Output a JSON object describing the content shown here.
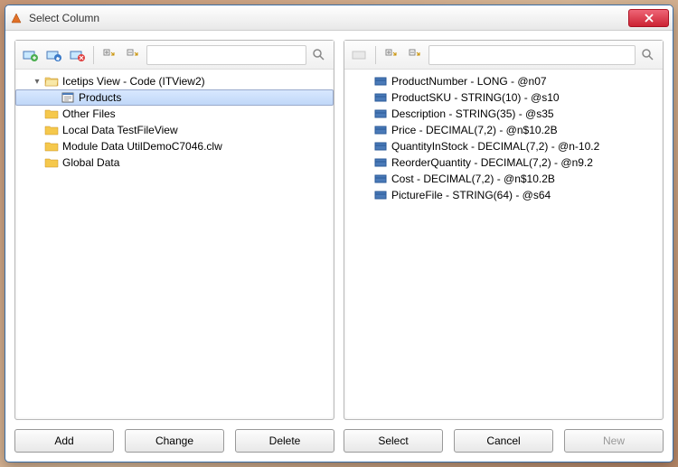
{
  "window": {
    "title": "Select Column"
  },
  "leftPanel": {
    "searchPlaceholder": "",
    "tree": [
      {
        "label": "Icetips View - Code (ITView2)",
        "indent": 0,
        "expandable": true,
        "expanded": true,
        "icon": "folder-open",
        "selected": false
      },
      {
        "label": "Products",
        "indent": 1,
        "expandable": false,
        "icon": "form",
        "selected": true
      },
      {
        "label": "Other Files",
        "indent": 0,
        "expandable": false,
        "icon": "folder-closed",
        "selected": false
      },
      {
        "label": "Local Data TestFileView",
        "indent": 0,
        "expandable": false,
        "icon": "folder-closed",
        "selected": false
      },
      {
        "label": "Module Data UtilDemoC7046.clw",
        "indent": 0,
        "expandable": false,
        "icon": "folder-closed",
        "selected": false
      },
      {
        "label": "Global Data",
        "indent": 0,
        "expandable": false,
        "icon": "folder-closed",
        "selected": false
      }
    ]
  },
  "rightPanel": {
    "searchPlaceholder": "",
    "items": [
      {
        "label": "ProductNumber - LONG - @n07"
      },
      {
        "label": "ProductSKU - STRING(10) - @s10"
      },
      {
        "label": "Description - STRING(35) - @s35"
      },
      {
        "label": "Price - DECIMAL(7,2) - @n$10.2B"
      },
      {
        "label": "QuantityInStock - DECIMAL(7,2) - @n-10.2"
      },
      {
        "label": "ReorderQuantity - DECIMAL(7,2) - @n9.2"
      },
      {
        "label": "Cost - DECIMAL(7,2) - @n$10.2B"
      },
      {
        "label": "PictureFile - STRING(64) - @s64"
      }
    ]
  },
  "buttons": {
    "add": "Add",
    "change": "Change",
    "delete": "Delete",
    "select": "Select",
    "cancel": "Cancel",
    "new": "New"
  }
}
